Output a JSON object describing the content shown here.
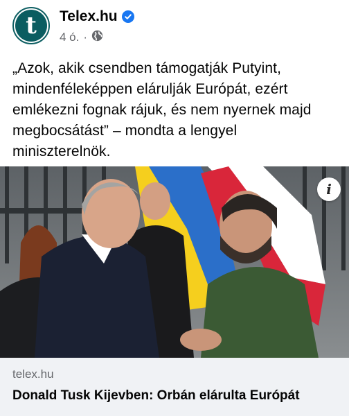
{
  "post": {
    "page_name": "Telex.hu",
    "avatar_letter": "t",
    "time": "4 ó.",
    "separator": "·",
    "text": "„Azok, akik csendben támogatják Putyint, mindenféleképpen elárulják Európát, ezért emlékezni fognak rájuk, és nem nyernek majd megbocsátást” – mondta a lengyel miniszterelnök."
  },
  "link_preview": {
    "domain": "telex.hu",
    "title": "Donald Tusk Kijevben: Orbán elárulta Európát",
    "info_glyph": "i"
  },
  "colors": {
    "brand_teal": "#0b5d61",
    "verified_blue": "#1877f2",
    "flag_blue": "#2b6fc9",
    "flag_yellow": "#f5cf1e",
    "flag_red": "#d9263a"
  },
  "icons": {
    "verified": "verified-badge-icon",
    "audience": "globe-icon",
    "info": "info-icon"
  }
}
